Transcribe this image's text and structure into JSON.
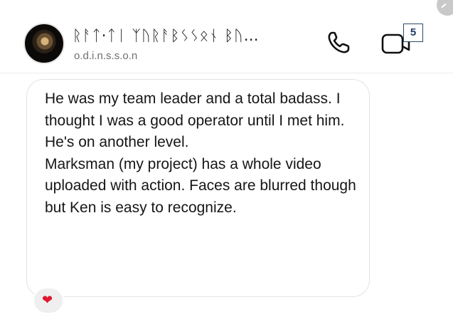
{
  "header": {
    "display_name": "ᚱᚨᛏ·ᛏᛁ ᛉᚢᚱᚨᛒᛊᛊᛟᚾ ᛒᚢ…",
    "username": "o.d.i.n.s.s.o.n",
    "badge_count": "5",
    "icons": {
      "call": "phone-icon",
      "video": "video-camera-icon",
      "corner": "check-icon"
    }
  },
  "message": {
    "paragraphs": [
      "He was my team leader and a total badass. I thought I was a good operator until I met him. He's on another level.",
      "Marksman (my project) has a whole video uploaded with action. Faces are blurred though but Ken is easy to recognize."
    ],
    "reaction": "❤",
    "reaction_icon": "heart-icon",
    "reaction_color": "#e0182d"
  }
}
